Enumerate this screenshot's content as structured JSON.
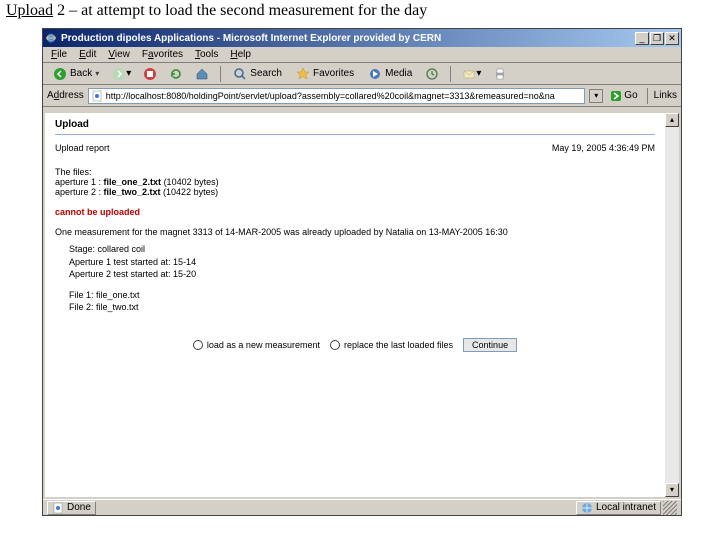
{
  "caption": {
    "underlined": "Upload",
    "rest": " 2 – at attempt to load the second measurement for the day"
  },
  "window": {
    "title": "Production dipoles Applications - Microsoft Internet Explorer provided by CERN",
    "btn_min": "_",
    "btn_max": "❐",
    "btn_close": "✕"
  },
  "menu": {
    "file": "File",
    "edit": "Edit",
    "view": "View",
    "favorites": "Favorites",
    "tools": "Tools",
    "help": "Help"
  },
  "toolbar": {
    "back": "Back",
    "search": "Search",
    "favorites": "Favorites",
    "media": "Media"
  },
  "address": {
    "label": "Address",
    "url": "http://localhost:8080/holdingPoint/servlet/upload?assembly=collared%20coil&magnet=3313&remeasured=no&na",
    "go": "Go",
    "links": "Links"
  },
  "page": {
    "upload_heading": "Upload",
    "report_label": "Upload report",
    "timestamp": "May 19, 2005 4:36:49 PM",
    "files_intro": "The files:",
    "ap1_label": "aperture 1 : ",
    "ap1_file": "file_one_2.txt",
    "ap1_size": " (10402 bytes)",
    "ap2_label": "aperture 2 : ",
    "ap2_file": "file_two_2.txt",
    "ap2_size": " (10422 bytes)",
    "error": "cannot be uploaded",
    "reason": "One measurement for the magnet 3313 of 14-MAR-2005 was already uploaded by Natalia on 13-MAY-2005 16:30",
    "stage": "Stage: collared coil",
    "ap1_start": "Aperture 1 test started at: 15-14",
    "ap2_start": "Aperture 2 test started at: 15-20",
    "f1": "File 1: file_one.txt",
    "f2": "File 2: file_two.txt",
    "opt_new": "load as a new measurement",
    "opt_replace": "replace the last loaded files",
    "continue": "Continue"
  },
  "status": {
    "left": "Done",
    "right": "Local intranet"
  }
}
